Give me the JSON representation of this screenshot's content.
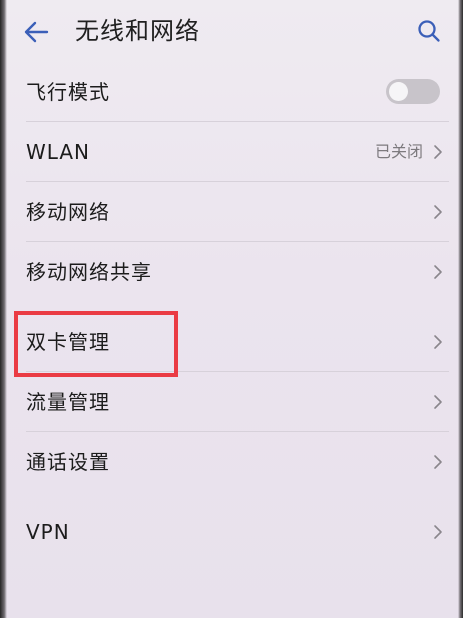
{
  "header": {
    "title": "无线和网络",
    "back_icon": "arrow-left-icon",
    "search_icon": "search-icon"
  },
  "items": [
    {
      "label": "飞行模式",
      "control": "toggle",
      "toggle_on": false
    },
    {
      "label": "WLAN",
      "value": "已关闭",
      "control": "chevron"
    },
    {
      "label": "移动网络",
      "control": "chevron"
    },
    {
      "label": "移动网络共享",
      "control": "chevron"
    },
    {
      "label": "双卡管理",
      "control": "chevron",
      "highlighted": true
    },
    {
      "label": "流量管理",
      "control": "chevron"
    },
    {
      "label": "通话设置",
      "control": "chevron"
    },
    {
      "label": "VPN",
      "control": "chevron"
    }
  ],
  "colors": {
    "accent": "#3b5fb8",
    "highlight_border": "#ea3b44",
    "background": "#ece6ef",
    "toggle_off": "#c8c4ca"
  }
}
